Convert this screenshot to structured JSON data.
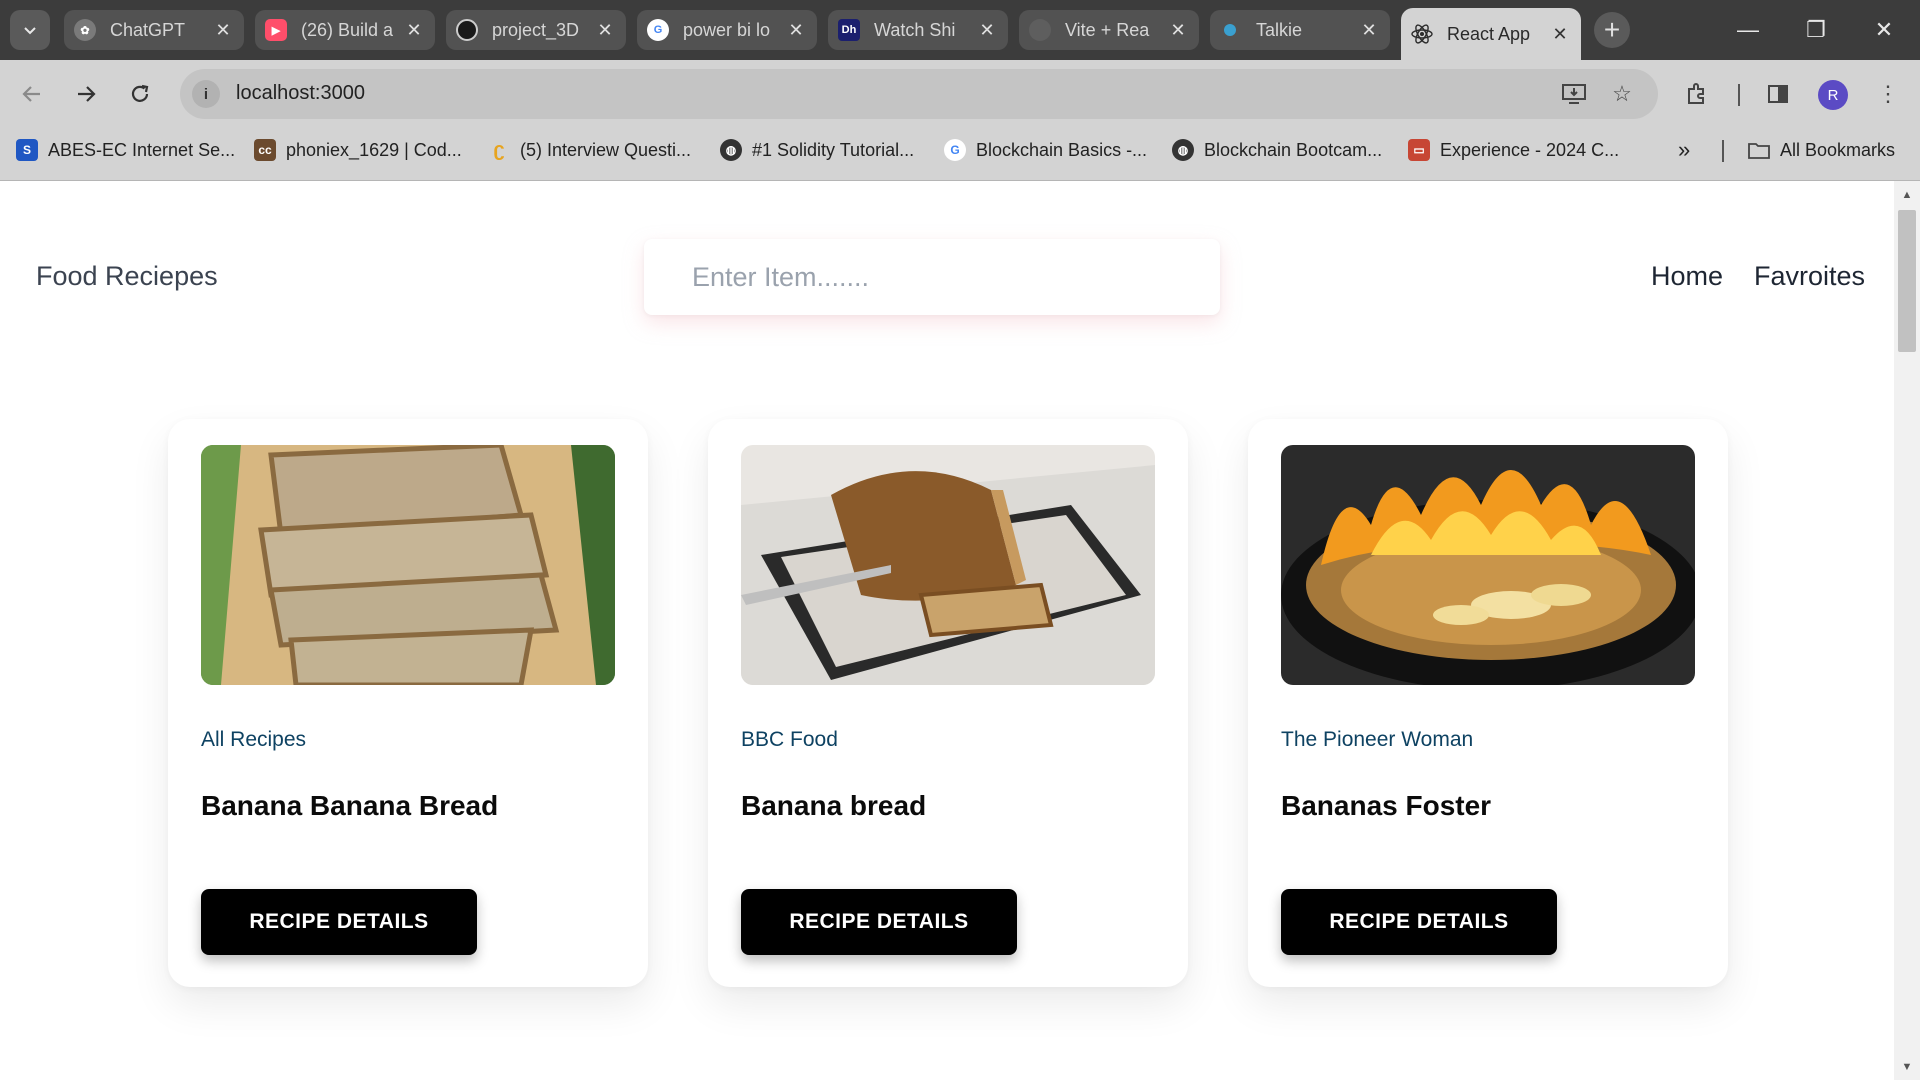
{
  "browser": {
    "tabs": [
      {
        "title": "ChatGPT",
        "icon": "chatgpt-icon",
        "color": "#10a37f"
      },
      {
        "title": "(26) Build a",
        "icon": "youtube-icon",
        "color": "#ff4e6a"
      },
      {
        "title": "project_3D",
        "icon": "github-icon",
        "color": "#222222"
      },
      {
        "title": "power bi lo",
        "icon": "google-icon",
        "color": "#4285f4"
      },
      {
        "title": "Watch Shi",
        "icon": "dh-icon",
        "color": "#1b1f6e"
      },
      {
        "title": "Vite + Rea",
        "icon": "vite-icon",
        "color": "#6b6b6b"
      },
      {
        "title": "Talkie",
        "icon": "talkie-icon",
        "color": "#3aa0d0"
      },
      {
        "title": "React App",
        "icon": "react-icon",
        "color": "#2b2b2b"
      }
    ],
    "new_tab_glyph": "+",
    "window_controls": {
      "minimize": "—",
      "restore": "❐",
      "close": "✕"
    },
    "url": "localhost:3000",
    "avatar_letter": "R",
    "bookmarks": [
      {
        "label": "ABES-EC Internet Se...",
        "icon": "s-icon",
        "color": "#1f57c3"
      },
      {
        "label": "phoniex_1629 | Cod...",
        "icon": "codechef-icon",
        "color": "#6b4a2e"
      },
      {
        "label": "(5) Interview Questi...",
        "icon": "leetcode-icon",
        "color": "#e7a41f"
      },
      {
        "label": "#1 Solidity Tutorial...",
        "icon": "globe-icon",
        "color": "#333333"
      },
      {
        "label": "Blockchain Basics -...",
        "icon": "google-icon",
        "color": "#4285f4"
      },
      {
        "label": "Blockchain Bootcam...",
        "icon": "globe-icon",
        "color": "#333333"
      },
      {
        "label": "Experience - 2024 C...",
        "icon": "oracle-icon",
        "color": "#c74634"
      }
    ],
    "bookmarks_overflow": "»",
    "all_bookmarks": "All Bookmarks"
  },
  "header": {
    "brand": "Food Reciepes",
    "search_placeholder": "Enter Item.......",
    "nav": [
      "Home",
      "Favroites"
    ]
  },
  "recipes": [
    {
      "publisher": "All Recipes",
      "title": "Banana Banana Bread",
      "button": "RECIPE DETAILS",
      "image": "sliced-banana-bread-photo"
    },
    {
      "publisher": "BBC Food",
      "title": "Banana bread",
      "button": "RECIPE DETAILS",
      "image": "banana-bread-loaf-photo"
    },
    {
      "publisher": "The Pioneer Woman",
      "title": "Bananas Foster",
      "button": "RECIPE DETAILS",
      "image": "flaming-skillet-photo"
    }
  ]
}
